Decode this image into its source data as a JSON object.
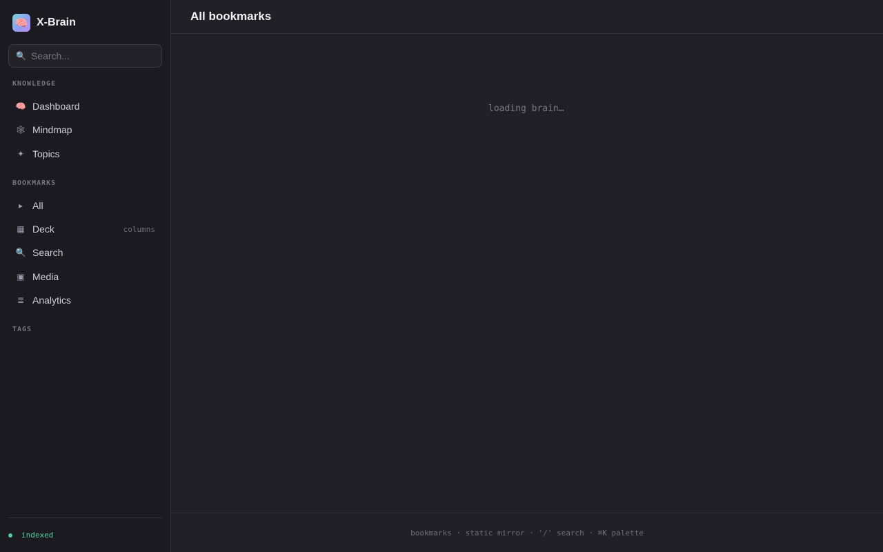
{
  "brand": {
    "name": "X-Brain",
    "logo_icon": "🧠"
  },
  "search": {
    "placeholder": "Search...",
    "icon": "🔍"
  },
  "sections": {
    "knowledge": "KNOWLEDGE",
    "bookmarks": "BOOKMARKS",
    "tags": "TAGS"
  },
  "knowledge_items": [
    {
      "label": "Dashboard",
      "icon": "🧠"
    },
    {
      "label": "Mindmap",
      "icon": "🕸"
    },
    {
      "label": "Topics",
      "icon": "✦"
    }
  ],
  "bookmark_items": [
    {
      "label": "All",
      "icon": "▸"
    },
    {
      "label": "Deck",
      "icon": "▦",
      "hint": "columns"
    },
    {
      "label": "Search",
      "icon": "🔍"
    },
    {
      "label": "Media",
      "icon": "▣"
    },
    {
      "label": "Analytics",
      "icon": "≣"
    }
  ],
  "status": {
    "text": "indexed",
    "color": "#4fd19a"
  },
  "header": {
    "title": "All bookmarks"
  },
  "main": {
    "loading_text": "loading brain…"
  },
  "footer": {
    "text": "bookmarks · static mirror · '/' search · ⌘K palette"
  },
  "colors": {
    "background": "#212027",
    "sidebar": "#1b1a20",
    "accent": "#4fd19a"
  }
}
